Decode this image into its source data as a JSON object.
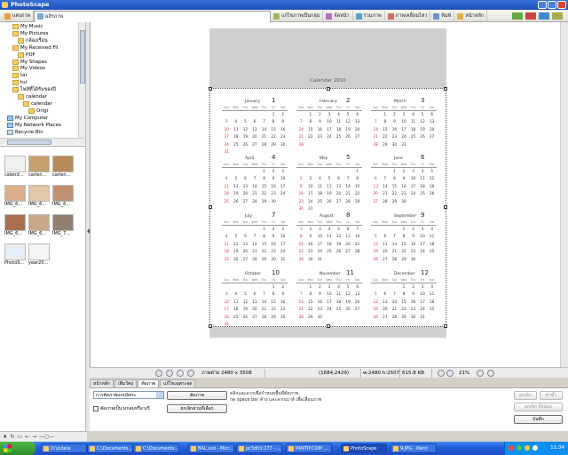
{
  "app_title": "PhotoScape",
  "menu": [
    {
      "label": "แต่งภาพ",
      "color": "#e8a040"
    },
    {
      "label": "ผลิรภาพ",
      "color": "#7aa7d8"
    },
    {
      "label": "แก้ไขภาพเป็นกลุ่ม",
      "color": "#9fb955"
    },
    {
      "label": "จัดหน้า",
      "color": "#b06fbf"
    },
    {
      "label": "รวมภาพ",
      "color": "#5aa0c8"
    },
    {
      "label": "ภาพเคลื่อนไหว",
      "color": "#d46a6a"
    },
    {
      "label": "พิมพ์",
      "color": "#6f8fd0"
    },
    {
      "label": "หน้าหลัก",
      "color": "#e0b040"
    }
  ],
  "selected_menu": "ผลิรภาพ",
  "tree": [
    {
      "label": "My Music",
      "indent": 2,
      "icon": "folder"
    },
    {
      "label": "My Pictures",
      "indent": 2,
      "icon": "folder"
    },
    {
      "label": "กล้องเรือน",
      "indent": 3,
      "icon": "folder"
    },
    {
      "label": "My Received Fil",
      "indent": 2,
      "icon": "folder"
    },
    {
      "label": "PDF",
      "indent": 3,
      "icon": "folder"
    },
    {
      "label": "My Shapes",
      "indent": 2,
      "icon": "folder"
    },
    {
      "label": "My Videos",
      "indent": 2,
      "icon": "folder"
    },
    {
      "label": "tai",
      "indent": 2,
      "icon": "folder"
    },
    {
      "label": "tui",
      "indent": 2,
      "icon": "folder"
    },
    {
      "label": "ไฟล์ที่ได้รับของปี",
      "indent": 2,
      "icon": "folder"
    },
    {
      "label": "calendar",
      "indent": 3,
      "icon": "folder"
    },
    {
      "label": "calendar",
      "indent": 4,
      "icon": "folder"
    },
    {
      "label": "Origi",
      "indent": 5,
      "icon": "folder"
    },
    {
      "label": "My Computer",
      "indent": 1,
      "icon": "computer"
    },
    {
      "label": "My Network Places",
      "indent": 1,
      "icon": "computer"
    },
    {
      "label": "Recycle Bin",
      "indent": 1,
      "icon": "bin"
    }
  ],
  "thumbnails": [
    {
      "label": "calend...",
      "color": "#f0f0f0"
    },
    {
      "label": "carlen...",
      "color": "#c8a070"
    },
    {
      "label": "carlen...",
      "color": "#b88a5a"
    },
    {
      "label": "IMG_6...",
      "color": "#d8b090"
    },
    {
      "label": "IMG_6...",
      "color": "#e0c8a8"
    },
    {
      "label": "IMG_6...",
      "color": "#c09070"
    },
    {
      "label": "IMG_6...",
      "color": "#a87050"
    },
    {
      "label": "IMG_6...",
      "color": "#c8a888"
    },
    {
      "label": "IMG_7...",
      "color": "#908070"
    },
    {
      "label": "PhotoS...",
      "color": "#e8eef8"
    },
    {
      "label": "year20...",
      "color": "#f4f4f4"
    }
  ],
  "calendar": {
    "title": "Calendar  2010",
    "weekdays": [
      "Sun",
      "Mon",
      "Tue",
      "Wed",
      "Thu",
      "Fri",
      "Sat"
    ],
    "months": [
      {
        "name": "January",
        "num": "1",
        "start": 5,
        "days": 31
      },
      {
        "name": "February",
        "num": "2",
        "start": 1,
        "days": 28
      },
      {
        "name": "March",
        "num": "3",
        "start": 1,
        "days": 31
      },
      {
        "name": "April",
        "num": "4",
        "start": 4,
        "days": 30
      },
      {
        "name": "May",
        "num": "5",
        "start": 6,
        "days": 31
      },
      {
        "name": "June",
        "num": "6",
        "start": 2,
        "days": 30
      },
      {
        "name": "July",
        "num": "7",
        "start": 4,
        "days": 31
      },
      {
        "name": "August",
        "num": "8",
        "start": 0,
        "days": 31
      },
      {
        "name": "September",
        "num": "9",
        "start": 3,
        "days": 30
      },
      {
        "name": "October",
        "num": "10",
        "start": 5,
        "days": 31
      },
      {
        "name": "November",
        "num": "11",
        "start": 1,
        "days": 30
      },
      {
        "name": "December",
        "num": "12",
        "start": 3,
        "days": 31
      }
    ]
  },
  "status": {
    "image_size": "ภาพต่าย 2480 x 3508",
    "coords": "(1684,2429)",
    "selection": "w:2480 h:2507",
    "file_size": "615.8 KB",
    "zoom": "21%"
  },
  "tabs": [
    "หน้าหลัก",
    "เพิ่มวัตถุ",
    "ตัดภาพ",
    "แก้ไขเฉพาะจุด"
  ],
  "selected_tab": "ตัดภาพ",
  "panel": {
    "crop_mode": "การตัดภาพแบบอิสระ",
    "crop_button": "ตัดภาพ",
    "round_checkbox": "ตัดภาพเป็นวงกลมหรือวงรี",
    "cancel_selection": "ยกเลิกส่วนที่เลือก",
    "hint_line1": "คลิกและลากเพื่อกำหนดพื้นที่ตัดภาพ",
    "hint_line2": "กด space bar ค้าง และลากเมาส์ เพื่อเลื่อนภาพ",
    "undo": "ยกเลิก",
    "redo": "ทำซ้ำ",
    "undo_all": "ยกเลิก ทั้งหมด",
    "save": "บันทึก"
  },
  "taskbar": {
    "items": [
      {
        "label": "D:\\jcdata"
      },
      {
        "label": "C:\\Documents..."
      },
      {
        "label": "C:\\Documents..."
      },
      {
        "label": "BAL.vsd - Micr..."
      },
      {
        "label": "pc3dh1:177 - ..."
      },
      {
        "label": "PANTIP.COM ..."
      },
      {
        "label": "PhotoScape"
      },
      {
        "label": "9.JPG - Paint"
      }
    ],
    "active": "PhotoScape",
    "clock": "11:34"
  }
}
